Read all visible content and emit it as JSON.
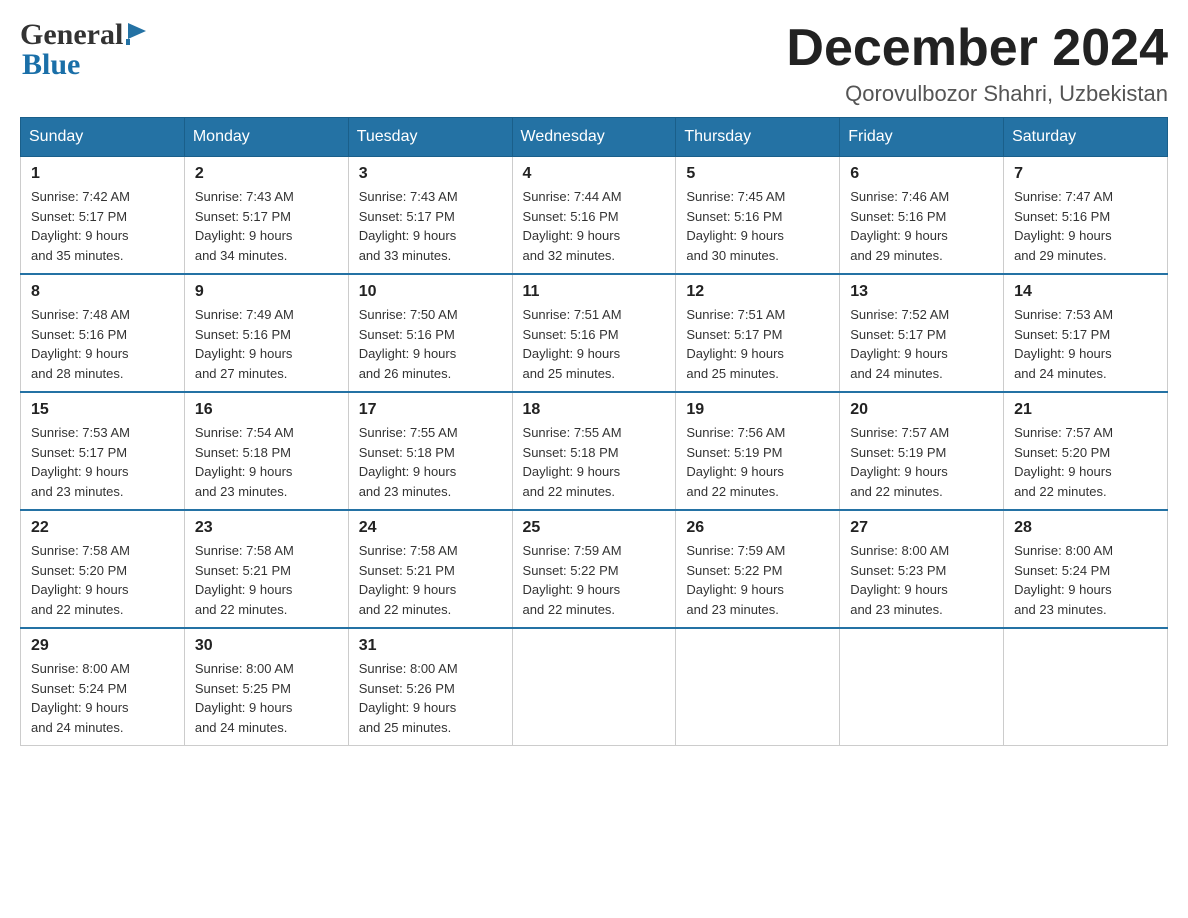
{
  "logo": {
    "general": "General",
    "blue": "Blue"
  },
  "header": {
    "title": "December 2024",
    "location": "Qorovulbozor Shahri, Uzbekistan"
  },
  "days_of_week": [
    "Sunday",
    "Monday",
    "Tuesday",
    "Wednesday",
    "Thursday",
    "Friday",
    "Saturday"
  ],
  "weeks": [
    [
      {
        "day": "1",
        "sunrise": "7:42 AM",
        "sunset": "5:17 PM",
        "daylight": "9 hours and 35 minutes."
      },
      {
        "day": "2",
        "sunrise": "7:43 AM",
        "sunset": "5:17 PM",
        "daylight": "9 hours and 34 minutes."
      },
      {
        "day": "3",
        "sunrise": "7:43 AM",
        "sunset": "5:17 PM",
        "daylight": "9 hours and 33 minutes."
      },
      {
        "day": "4",
        "sunrise": "7:44 AM",
        "sunset": "5:16 PM",
        "daylight": "9 hours and 32 minutes."
      },
      {
        "day": "5",
        "sunrise": "7:45 AM",
        "sunset": "5:16 PM",
        "daylight": "9 hours and 30 minutes."
      },
      {
        "day": "6",
        "sunrise": "7:46 AM",
        "sunset": "5:16 PM",
        "daylight": "9 hours and 29 minutes."
      },
      {
        "day": "7",
        "sunrise": "7:47 AM",
        "sunset": "5:16 PM",
        "daylight": "9 hours and 29 minutes."
      }
    ],
    [
      {
        "day": "8",
        "sunrise": "7:48 AM",
        "sunset": "5:16 PM",
        "daylight": "9 hours and 28 minutes."
      },
      {
        "day": "9",
        "sunrise": "7:49 AM",
        "sunset": "5:16 PM",
        "daylight": "9 hours and 27 minutes."
      },
      {
        "day": "10",
        "sunrise": "7:50 AM",
        "sunset": "5:16 PM",
        "daylight": "9 hours and 26 minutes."
      },
      {
        "day": "11",
        "sunrise": "7:51 AM",
        "sunset": "5:16 PM",
        "daylight": "9 hours and 25 minutes."
      },
      {
        "day": "12",
        "sunrise": "7:51 AM",
        "sunset": "5:17 PM",
        "daylight": "9 hours and 25 minutes."
      },
      {
        "day": "13",
        "sunrise": "7:52 AM",
        "sunset": "5:17 PM",
        "daylight": "9 hours and 24 minutes."
      },
      {
        "day": "14",
        "sunrise": "7:53 AM",
        "sunset": "5:17 PM",
        "daylight": "9 hours and 24 minutes."
      }
    ],
    [
      {
        "day": "15",
        "sunrise": "7:53 AM",
        "sunset": "5:17 PM",
        "daylight": "9 hours and 23 minutes."
      },
      {
        "day": "16",
        "sunrise": "7:54 AM",
        "sunset": "5:18 PM",
        "daylight": "9 hours and 23 minutes."
      },
      {
        "day": "17",
        "sunrise": "7:55 AM",
        "sunset": "5:18 PM",
        "daylight": "9 hours and 23 minutes."
      },
      {
        "day": "18",
        "sunrise": "7:55 AM",
        "sunset": "5:18 PM",
        "daylight": "9 hours and 22 minutes."
      },
      {
        "day": "19",
        "sunrise": "7:56 AM",
        "sunset": "5:19 PM",
        "daylight": "9 hours and 22 minutes."
      },
      {
        "day": "20",
        "sunrise": "7:57 AM",
        "sunset": "5:19 PM",
        "daylight": "9 hours and 22 minutes."
      },
      {
        "day": "21",
        "sunrise": "7:57 AM",
        "sunset": "5:20 PM",
        "daylight": "9 hours and 22 minutes."
      }
    ],
    [
      {
        "day": "22",
        "sunrise": "7:58 AM",
        "sunset": "5:20 PM",
        "daylight": "9 hours and 22 minutes."
      },
      {
        "day": "23",
        "sunrise": "7:58 AM",
        "sunset": "5:21 PM",
        "daylight": "9 hours and 22 minutes."
      },
      {
        "day": "24",
        "sunrise": "7:58 AM",
        "sunset": "5:21 PM",
        "daylight": "9 hours and 22 minutes."
      },
      {
        "day": "25",
        "sunrise": "7:59 AM",
        "sunset": "5:22 PM",
        "daylight": "9 hours and 22 minutes."
      },
      {
        "day": "26",
        "sunrise": "7:59 AM",
        "sunset": "5:22 PM",
        "daylight": "9 hours and 23 minutes."
      },
      {
        "day": "27",
        "sunrise": "8:00 AM",
        "sunset": "5:23 PM",
        "daylight": "9 hours and 23 minutes."
      },
      {
        "day": "28",
        "sunrise": "8:00 AM",
        "sunset": "5:24 PM",
        "daylight": "9 hours and 23 minutes."
      }
    ],
    [
      {
        "day": "29",
        "sunrise": "8:00 AM",
        "sunset": "5:24 PM",
        "daylight": "9 hours and 24 minutes."
      },
      {
        "day": "30",
        "sunrise": "8:00 AM",
        "sunset": "5:25 PM",
        "daylight": "9 hours and 24 minutes."
      },
      {
        "day": "31",
        "sunrise": "8:00 AM",
        "sunset": "5:26 PM",
        "daylight": "9 hours and 25 minutes."
      },
      null,
      null,
      null,
      null
    ]
  ],
  "labels": {
    "sunrise": "Sunrise:",
    "sunset": "Sunset:",
    "daylight": "Daylight:"
  }
}
